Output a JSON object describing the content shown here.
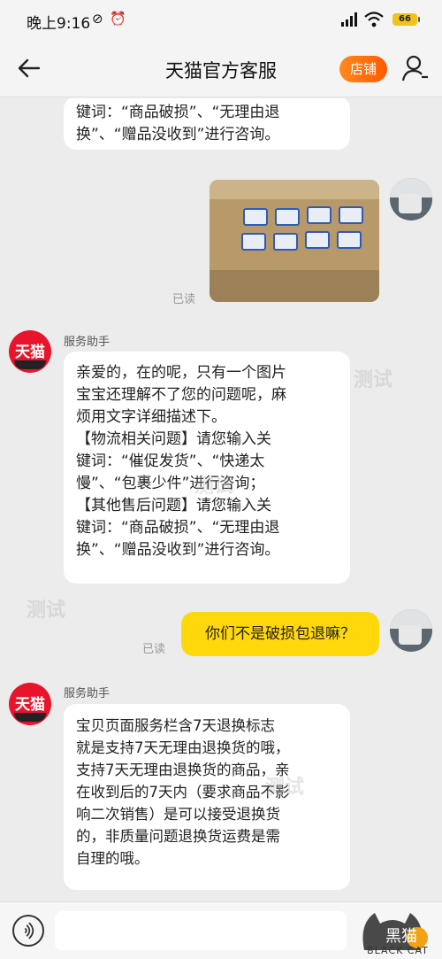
{
  "status_bar": {
    "time": "晚上9:16",
    "battery": "66",
    "icons": [
      "mute-icon",
      "alarm-icon",
      "signal-icon",
      "wifi-icon",
      "battery-icon"
    ]
  },
  "header": {
    "back_icon": "arrow-left-icon",
    "title": "天猫官方客服",
    "shop_button": "店铺",
    "user_icon": "user-icon"
  },
  "messages": [
    {
      "from": "bot",
      "text": "键词：“商品破损”、“无理由退\n换”、“赠品没收到”进行咨询。"
    },
    {
      "from": "user",
      "type": "image",
      "status": "已读"
    },
    {
      "from": "bot",
      "sender": "服务助手",
      "avatar": "天猫",
      "text": "亲爱的，在的呢，只有一个图片\n宝宝还理解不了您的问题呢，麻\n烦用文字详细描述下。\n【物流相关问题】请您输入关\n键词：“催促发货”、“快递太\n慢”、“包裹少件”进行咨询；\n【其他售后问题】请您输入关\n键词：“商品破损”、“无理由退\n换”、“赠品没收到”进行咨询。"
    },
    {
      "from": "user",
      "text": "你们不是破损包退嘛？",
      "status": "已读"
    },
    {
      "from": "bot",
      "sender": "服务助手",
      "avatar": "天猫",
      "text": "宝贝页面服务栏含7天退换标志\n就是支持7天无理由退换货的哦，\n支持7天无理由退换货的商品，亲\n在收到后的7天内（要求商品不影\n响二次销售）是可以接受退换货\n的，非质量问题退换货运费是需\n自理的哦。"
    }
  ],
  "input_bar": {
    "voice_icon": "voice-icon",
    "placeholder": ""
  },
  "watermark": {
    "text": "测试",
    "logo_text": "BLACK CAT",
    "logo_glyph": "黑猫"
  },
  "colors": {
    "accent": "#ff6a00",
    "user_bubble": "#ffd80b",
    "bot_avatar": "#e8142c",
    "background": "#ececec"
  }
}
